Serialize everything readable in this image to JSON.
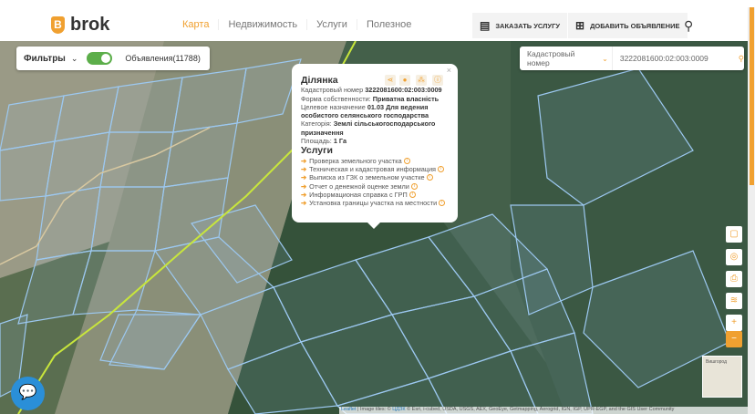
{
  "header": {
    "logo": "brok",
    "logo_letter": "B",
    "nav": [
      "Карта",
      "Недвижимость",
      "Услуги",
      "Полезное"
    ],
    "order_service": "ЗАКАЗАТЬ УСЛУГУ",
    "add_listing": "ДОБАВИТЬ ОБЪЯВЛЕНИЕ"
  },
  "filters": {
    "label": "Фильтры",
    "listings": "Объявления(11788)",
    "toggle_on": true
  },
  "search": {
    "type": "Кадастровый номер",
    "value": "3222081600:02:003:0009"
  },
  "popup": {
    "title": "Ділянка",
    "fields": [
      {
        "label": "Кадастровый номер",
        "value": "3222081600:02:003:0009"
      },
      {
        "label": "Форма собственности:",
        "value": "Приватна власність"
      },
      {
        "label": "Целевое назначение",
        "value": "01.03 Для ведения особистого селянського господарства"
      },
      {
        "label": "Категорія:",
        "value": "Землі сільськогосподарського призначення"
      },
      {
        "label": "Площадь:",
        "value": "1 Га"
      }
    ],
    "services_title": "Услуги",
    "services": [
      "Проверка земельного участка",
      "Техническая и кадастровая информация",
      "Выписка из ГЗК о земельном участке",
      "Отчет о денежной оценке земли",
      "Информационая справка с ГРП",
      "Установка границы участка на местности"
    ]
  },
  "map": {
    "minimap_label": "Вишгород",
    "zoom_in": "+",
    "zoom_out": "−"
  },
  "attribution": {
    "leaflet": "Leaflet",
    "text": " | Image tiles: © ",
    "udzk": "ЦДЗК",
    "rest": " © Esri, i-cubed, USDA, USGS, AEX, GeoEye, Getmapping, Aerogrid, IGN, IGP, UPR-EGP, and the GIS User Community"
  },
  "colors": {
    "accent": "#f0a030",
    "parcel": "#9cc8f0",
    "boundary": "#c8e63c"
  }
}
